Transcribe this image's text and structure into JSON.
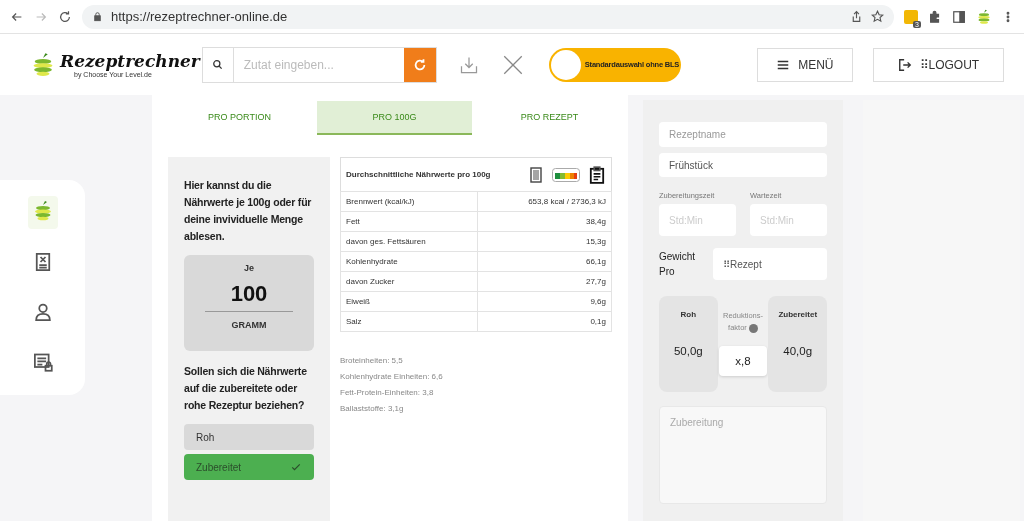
{
  "browser": {
    "url": "https://rezeptrechner-online.de",
    "extension_badge": "3"
  },
  "header": {
    "logo": {
      "name": "Rezeptrechner",
      "tagline": "by Choose Your Level.de"
    },
    "search": {
      "placeholder": "Zutat eingeben..."
    },
    "toggle": {
      "label": "Standardauswahl ohne BLS",
      "on": true
    },
    "menu_button": "MENÜ",
    "logout_button": "⠿LOGOUT"
  },
  "sidebar": {
    "items": [
      {
        "kind": "logo",
        "selected": true
      },
      {
        "kind": "document",
        "selected": false
      },
      {
        "kind": "user",
        "selected": false
      },
      {
        "kind": "list",
        "selected": false
      }
    ]
  },
  "tabs": [
    {
      "label": "PRO PORTION",
      "selected": false
    },
    {
      "label": "PRO 100G",
      "selected": true
    },
    {
      "label": "PRO REZEPT",
      "selected": false
    }
  ],
  "info": {
    "text": "Hier kannst du die Nährwerte je 100g oder für deine invividuelle Menge ablesen.",
    "amount_label": "Je",
    "amount": "100",
    "unit": "GRAMM",
    "question": "Sollen sich die Nährwerte auf die zubereitete oder rohe Rezeptur beziehen?",
    "options": [
      {
        "label": "Roh",
        "selected": false
      },
      {
        "label": "Zubereitet",
        "selected": true
      }
    ]
  },
  "table": {
    "title": "Durchschnittliche Nährwerte pro 100g",
    "rows": [
      {
        "name": "Brennwert (kcal/kJ)",
        "value": "653,8 kcal / 2736,3 kJ"
      },
      {
        "name": "Fett",
        "value": "38,4g"
      },
      {
        "name": "davon ges. Fettsäuren",
        "value": "15,3g"
      },
      {
        "name": "Kohlenhydrate",
        "value": "66,1g"
      },
      {
        "name": "davon Zucker",
        "value": "27,7g"
      },
      {
        "name": "Eiweiß",
        "value": "9,6g"
      },
      {
        "name": "Salz",
        "value": "0,1g"
      }
    ]
  },
  "units": [
    "Broteinheiten: 5,5",
    "Kohlenhydrate Einheiten: 6,6",
    "Fett-Protein-Einheiten: 3,8",
    "Ballaststoffe: 3,1g"
  ],
  "recipe": {
    "name_placeholder": "Rezeptname",
    "category": "Frühstück",
    "prep_label": "Zubereitungszeit",
    "prep_placeholder": "Std:Min",
    "wait_label": "Wartezeit",
    "wait_placeholder": "Std:Min",
    "weight_label": "Gewicht Pro",
    "weight_value": "⠿Rezept",
    "raw_label": "Roh",
    "raw_value": "50,0g",
    "factor_label": "Reduktions-faktor",
    "factor_value": "x,8",
    "cooked_label": "Zubereitet",
    "cooked_value": "40,0g",
    "preparation_placeholder": "Zubereitung"
  }
}
